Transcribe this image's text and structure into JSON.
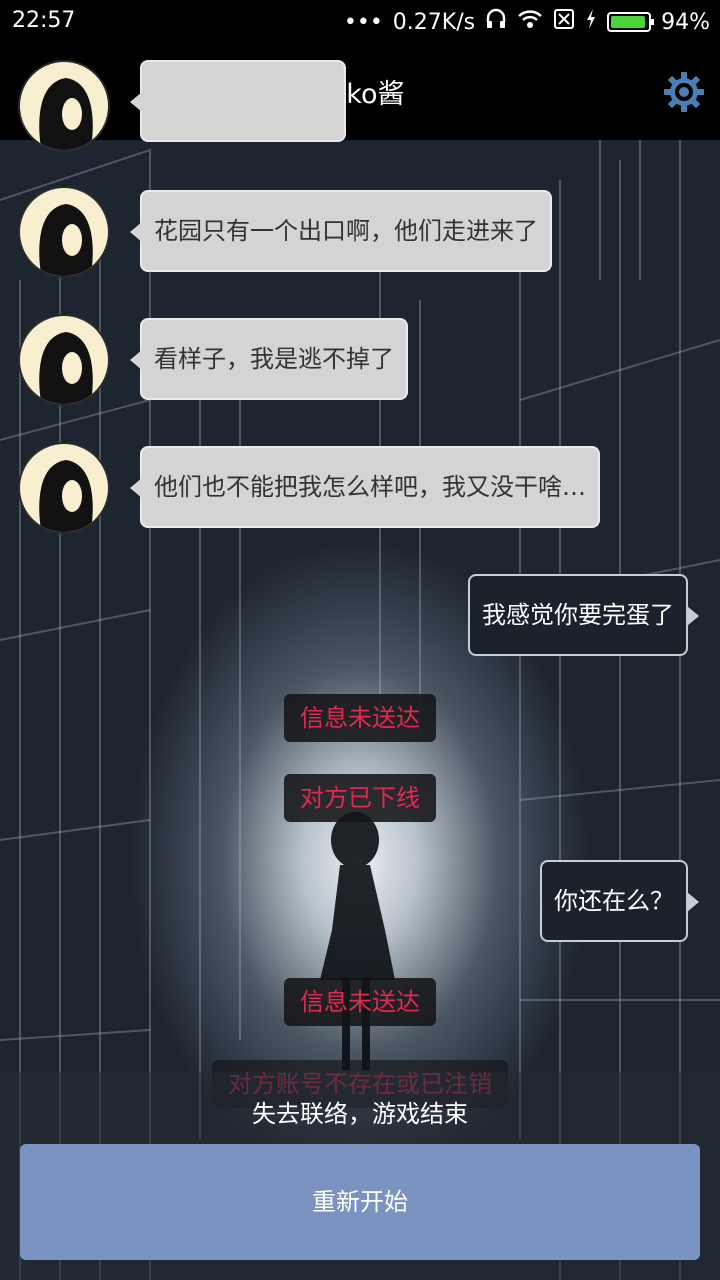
{
  "status_bar": {
    "time": "22:57",
    "net_speed": "0.27K/s",
    "battery_percent": "94%",
    "battery_level": 0.94,
    "battery_color": "#4cd33a",
    "icons": [
      "more-dots-icon",
      "headset-icon",
      "wifi-icon",
      "sim-off-icon",
      "charging-bolt-icon",
      "battery-icon"
    ]
  },
  "header": {
    "title": "Miko酱",
    "settings_icon": "gear-icon",
    "accent_color": "#4a7fb6"
  },
  "chat": {
    "incoming": [
      {
        "text": ""
      },
      {
        "text": "花园只有一个出口啊，他们走进来了"
      },
      {
        "text": "看样子，我是逃不掉了"
      },
      {
        "text": "他们也不能把我怎么样吧，我又没干啥…"
      }
    ],
    "outgoing": [
      {
        "text": "我感觉你要完蛋了"
      },
      {
        "text": "你还在么？"
      }
    ],
    "system": [
      {
        "text": "信息未送达"
      },
      {
        "text": "对方已下线"
      },
      {
        "text": "信息未送达"
      },
      {
        "text": "对方账号不存在或已注销"
      }
    ],
    "system_color": "#e2294f"
  },
  "footer": {
    "game_over_text": "失去联络，游戏结束",
    "restart_label": "重新开始",
    "button_color": "#7b93c0"
  }
}
